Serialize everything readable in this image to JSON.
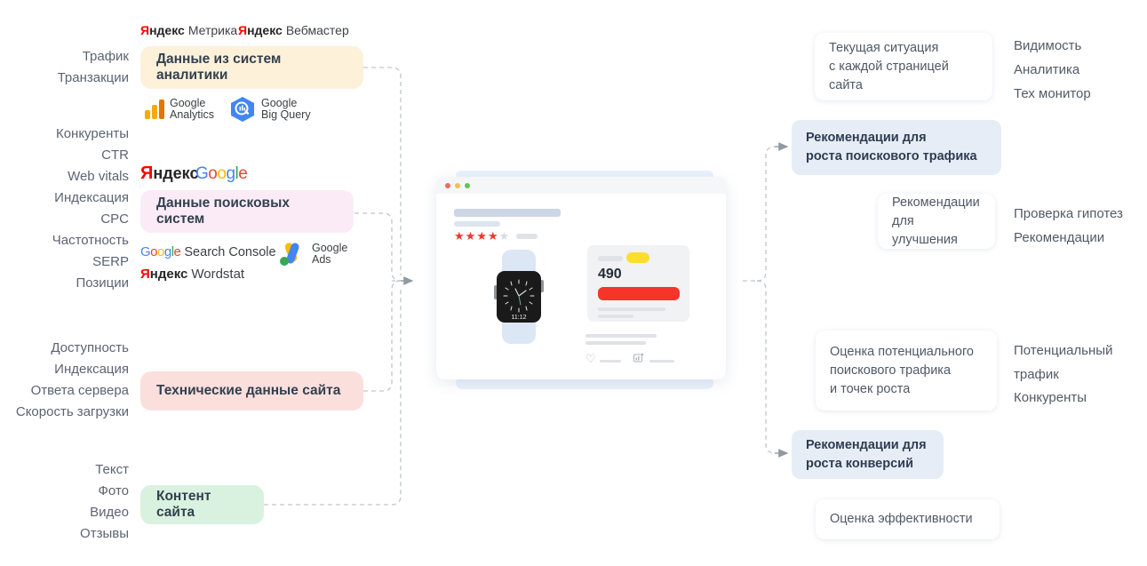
{
  "left_metric_groups": [
    {
      "name": "analytics-metrics",
      "items": [
        "Трафик",
        "Транзакции"
      ]
    },
    {
      "name": "search-metrics",
      "items": [
        "Конкуренты",
        "CTR",
        "Web vitals",
        "Индексация",
        "CPC",
        "Частотность",
        "SERP",
        "Позиции"
      ]
    },
    {
      "name": "tech-metrics",
      "items": [
        "Доступность",
        "Индексация",
        "Ответа сервера",
        "Скорость загрузки"
      ]
    },
    {
      "name": "content-metrics",
      "items": [
        "Текст",
        "Фото",
        "Видео",
        "Отзывы"
      ]
    }
  ],
  "source_blocks": {
    "analytics": {
      "label": "Данные из систем аналитики",
      "color": "#fdf1da",
      "logos_above": [
        {
          "name": "yandex-metrica-logo",
          "mark": "Я",
          "rest": "ндекс",
          "suffix": "Метрика"
        },
        {
          "name": "yandex-webmaster-logo",
          "mark": "Я",
          "rest": "ндекс",
          "suffix": "Вебмастер"
        }
      ],
      "logos_below": [
        {
          "name": "google-analytics-logo",
          "line1": "Google",
          "line2": "Analytics"
        },
        {
          "name": "google-bigquery-logo",
          "line1": "Google",
          "line2": "Big Query"
        }
      ]
    },
    "search": {
      "label": "Данные поисковых систем",
      "color": "#fbebf7",
      "logos_above": [
        {
          "name": "yandex-logo",
          "mark": "Я",
          "rest": "ндекс"
        },
        {
          "name": "google-logo",
          "letters": [
            "G",
            "o",
            "o",
            "g",
            "l",
            "e"
          ]
        }
      ],
      "logos_below": [
        {
          "name": "google-search-console-logo",
          "brand": "Google",
          "suffix": "Search Console"
        },
        {
          "name": "google-ads-logo",
          "line1": "Google",
          "line2": "Ads"
        },
        {
          "name": "yandex-wordstat-logo",
          "mark": "Я",
          "rest": "ндекс",
          "suffix": "Wordstat"
        }
      ]
    },
    "tech": {
      "label": "Технические данные  сайта",
      "color": "#fbdfdc"
    },
    "content": {
      "label": "Контент сайта",
      "color": "#d9f2e0"
    }
  },
  "center": {
    "name": "product-page-browser-mockup",
    "price": "490",
    "rating_filled": 4,
    "rating_total": 5,
    "watch_time": "11:12",
    "traffic_dots": [
      "red",
      "yellow",
      "green"
    ]
  },
  "output_cards": [
    {
      "name": "current-situation-card",
      "style": "white",
      "lines": [
        "Текущая ситуация",
        "с каждой страницей сайта"
      ]
    },
    {
      "name": "search-traffic-growth-card",
      "style": "blue",
      "lines": [
        "Рекомендации для",
        "роста поискового трафика"
      ]
    },
    {
      "name": "improvement-recommendations-card",
      "style": "white",
      "lines": [
        "Рекомендации",
        "для улучшения"
      ]
    },
    {
      "name": "potential-traffic-card",
      "style": "white",
      "lines": [
        "Оценка потенциального",
        "поискового трафика",
        "и точек роста"
      ]
    },
    {
      "name": "conversion-growth-card",
      "style": "blue",
      "lines": [
        "Рекомендации для",
        "роста конверсий"
      ]
    },
    {
      "name": "effectiveness-card",
      "style": "white",
      "lines": [
        "Оценка эффективности"
      ]
    }
  ],
  "output_keyword_groups": [
    {
      "name": "visibility-keywords",
      "items": [
        "Видимость",
        "Аналитика",
        "Тех монитор"
      ]
    },
    {
      "name": "hypothesis-keywords",
      "items": [
        "Проверка гипотез",
        "Рекомендации"
      ]
    },
    {
      "name": "potential-keywords",
      "items": [
        "Потенциальный",
        "трафик"
      ]
    },
    {
      "name": "competitors-keywords",
      "items": [
        "Конкуренты"
      ]
    }
  ],
  "colors": {
    "accent_red": "#f5342a",
    "accent_yellow": "#ffdd2d",
    "card_blue": "#e6edf7",
    "connector_gray": "#b5bcc6"
  }
}
